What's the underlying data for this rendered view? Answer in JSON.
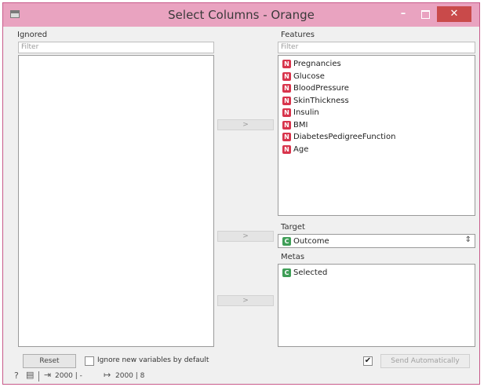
{
  "window": {
    "title": "Select Columns - Orange"
  },
  "ignored": {
    "label": "Ignored",
    "filter_placeholder": "Filter",
    "items": []
  },
  "features": {
    "label": "Features",
    "filter_placeholder": "Filter",
    "items": [
      {
        "type": "N",
        "name": "Pregnancies"
      },
      {
        "type": "N",
        "name": "Glucose"
      },
      {
        "type": "N",
        "name": "BloodPressure"
      },
      {
        "type": "N",
        "name": "SkinThickness"
      },
      {
        "type": "N",
        "name": "Insulin"
      },
      {
        "type": "N",
        "name": "BMI"
      },
      {
        "type": "N",
        "name": "DiabetesPedigreeFunction"
      },
      {
        "type": "N",
        "name": "Age"
      }
    ]
  },
  "target": {
    "label": "Target",
    "selected": {
      "type": "C",
      "name": "Outcome"
    },
    "spin_glyph": "⇕"
  },
  "metas": {
    "label": "Metas",
    "items": [
      {
        "type": "C",
        "name": "Selected"
      }
    ]
  },
  "move_buttons": {
    "features": ">",
    "target": ">",
    "metas": ">"
  },
  "footer": {
    "reset_label": "Reset",
    "ignore_new_label": "Ignore new variables by default",
    "ignore_new_checked": false,
    "send_auto_checked": true,
    "send_auto_check_glyph": "✔",
    "send_auto_label": "Send Automatically"
  },
  "statusbar": {
    "input_count": "2000 | -",
    "output_count": "2000 | 8"
  },
  "colors": {
    "numeric_badge": "#d8344c",
    "categorical_badge": "#3f9e57",
    "titlebar": "#e9a3c0",
    "close": "#c94a4a"
  }
}
